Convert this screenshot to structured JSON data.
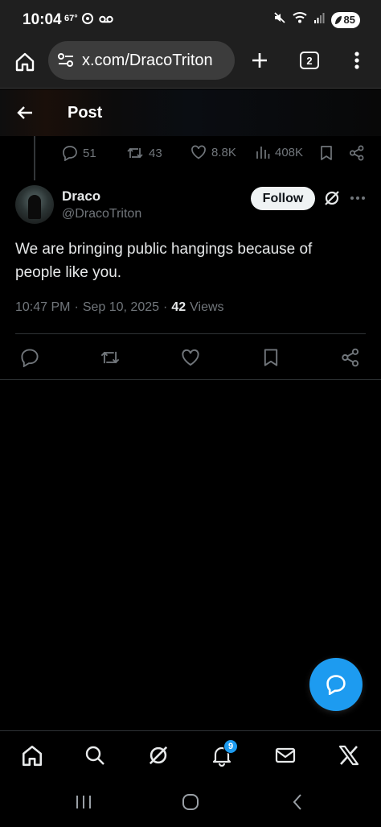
{
  "status_bar": {
    "time": "10:04",
    "temperature": "67°",
    "battery": "85",
    "icons": [
      "sync-icon",
      "voicemail-icon",
      "mute-icon",
      "wifi-icon",
      "signal-icon",
      "battery-icon"
    ]
  },
  "browser": {
    "url": "x.com/DracoTriton",
    "tab_count": "2",
    "icons": [
      "home-icon",
      "site-settings-icon",
      "new-tab-icon",
      "tabs-icon",
      "menu-icon"
    ]
  },
  "header": {
    "title": "Post"
  },
  "parent_actions": {
    "replies": "51",
    "reposts": "43",
    "likes": "8.8K",
    "views": "408K"
  },
  "tweet": {
    "author_name": "Draco",
    "author_handle": "@DracoTriton",
    "follow_label": "Follow",
    "text": "We are bringing public hangings because of people like you.",
    "time": "10:47 PM",
    "date": "Sep 10, 2025",
    "views_count": "42",
    "views_label": "Views"
  },
  "bottom_nav": {
    "notification_count": "9",
    "items": [
      "home-icon",
      "search-icon",
      "grok-icon",
      "notifications-icon",
      "messages-icon",
      "x-icon"
    ]
  },
  "colors": {
    "background": "#000000",
    "accent": "#1d9bf0",
    "secondary_text": "#71767b",
    "primary_text": "#e7e9ea",
    "browser_chrome": "#1f1f1f"
  }
}
